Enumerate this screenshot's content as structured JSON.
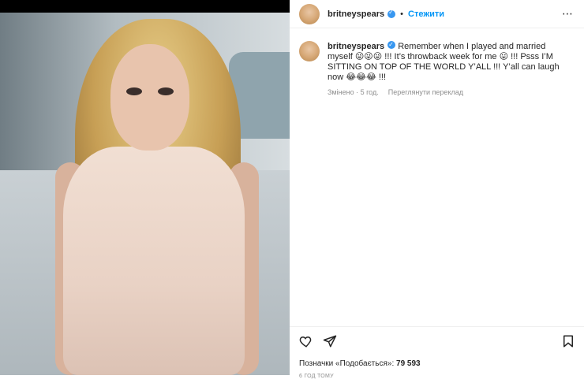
{
  "post": {
    "username": "britneyspears",
    "follow_label": "Стежити",
    "more_label": "⋯",
    "caption_text": "Remember when I played and married myself 😜😜😜 !!! It’s throwback week for me 😛 !!! Psss I’M SITTING ON TOP OF THE WORLD Y’ALL !!! Y’all can laugh now 😂😂😂 !!!",
    "edited_label": "Змінено",
    "time_short": "5 год.",
    "translate_label": "Переглянути переклад",
    "likes_label": "Позначки «Подобається»:",
    "likes_count": "79 593",
    "timestamp": "6 ГОД ТОМУ"
  },
  "icons": {
    "verified": "verified-badge-icon",
    "like": "heart-icon",
    "share": "send-icon",
    "save": "bookmark-icon",
    "more": "more-options-icon"
  },
  "colors": {
    "accent": "#0095f6",
    "verified": "#3897f0",
    "text": "#262626",
    "muted": "#8e8e8e"
  }
}
